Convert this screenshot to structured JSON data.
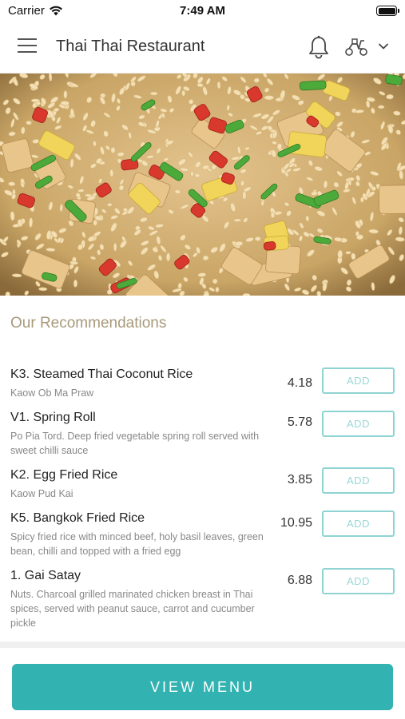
{
  "status_bar": {
    "carrier": "Carrier",
    "time": "7:49 AM"
  },
  "header": {
    "title": "Thai Thai Restaurant",
    "icons": [
      "menu-icon",
      "bell-icon",
      "delivery-scooter-icon",
      "chevron-down-icon"
    ]
  },
  "hero": {
    "icon": "fried-rice-photo"
  },
  "recommendations": {
    "title": "Our Recommendations",
    "items": [
      {
        "name": "K3. Steamed Thai Coconut Rice",
        "desc": "Kaow Ob Ma Praw",
        "price": "4.18",
        "add": "ADD"
      },
      {
        "name": "V1. Spring Roll",
        "desc": "Po Pia Tord. Deep fried vegetable spring roll served with sweet chilli sauce",
        "price": "5.78",
        "add": "ADD"
      },
      {
        "name": "K2. Egg Fried Rice",
        "desc": "Kaow Pud Kai",
        "price": "3.85",
        "add": "ADD"
      },
      {
        "name": "K5. Bangkok Fried Rice",
        "desc": "Spicy fried rice with minced beef, holy basil leaves, green bean, chilli and topped with a fried egg",
        "price": "10.95",
        "add": "ADD"
      },
      {
        "name": "1. Gai Satay",
        "desc": "Nuts. Charcoal grilled marinated chicken breast in Thai spices, served with peanut sauce, carrot and cucumber pickle",
        "price": "6.88",
        "add": "ADD"
      }
    ]
  },
  "footer": {
    "view_menu": "VIEW MENU"
  },
  "colors": {
    "accent": "#33b2b2",
    "add_border": "#8fd3d3",
    "section_title": "#a8997a"
  }
}
